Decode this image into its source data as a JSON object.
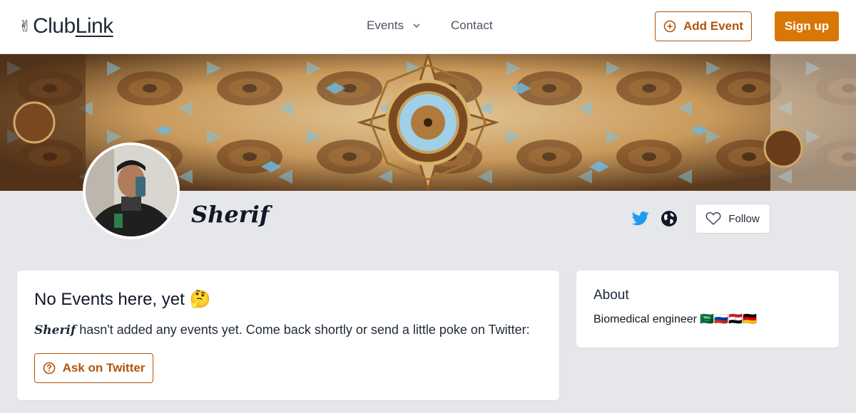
{
  "header": {
    "logo_emoji": "✌",
    "logo_text_a": "Club",
    "logo_text_b": "Link",
    "nav": {
      "events_label": "Events",
      "contact_label": "Contact"
    },
    "add_event_label": "Add Event",
    "sign_up_label": "Sign up"
  },
  "profile": {
    "name": "Sherif",
    "follow_label": "Follow",
    "social_icons": [
      "twitter-icon",
      "globe-icon"
    ]
  },
  "events_card": {
    "title": "No Events here, yet 🤔",
    "message_name": "Sherif",
    "message_text": " hasn't added any events yet. Come back shortly or send a little poke on Twitter:",
    "ask_button_label": "Ask on Twitter"
  },
  "about_card": {
    "title": "About",
    "bio": "Biomedical engineer 🇸🇦🇷🇺🇪🇬🇩🇪"
  },
  "colors": {
    "accent": "#d97706",
    "accent_dark": "#b45309",
    "twitter": "#1d9bf0",
    "page_bg": "#e5e7eb"
  }
}
